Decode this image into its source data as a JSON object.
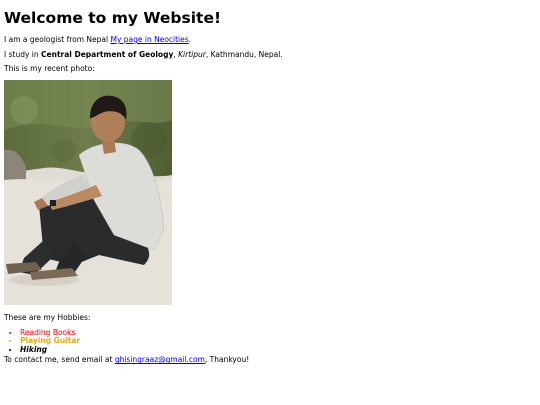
{
  "page": {
    "title": "Welcome to my Website!",
    "intro": {
      "prefix": "I am a geologist from Nepal ",
      "link_text": "My page in Neocities",
      "suffix": "."
    },
    "study": {
      "prefix": "I study in ",
      "department": "Central Department of Geology",
      "comma": ", ",
      "place": "Kirtipur",
      "suffix": ", Kathmandu, Nepal."
    },
    "photo_caption": "This is my recent photo:",
    "hobbies_heading": "These are my Hobbies:",
    "hobbies": [
      {
        "label": "Reading Books",
        "color": "#ff0000"
      },
      {
        "label": "Playing Guitar",
        "color": "#e6a817"
      },
      {
        "label": "Hiking",
        "color": "#000000"
      }
    ],
    "contact": {
      "prefix": "To contact me, send email at ",
      "email": "ghisingraaz@gmail.com",
      "suffix": ", Thankyou!"
    }
  },
  "colors": {
    "link": "#0000ee",
    "text": "#000000",
    "background": "#ffffff"
  }
}
